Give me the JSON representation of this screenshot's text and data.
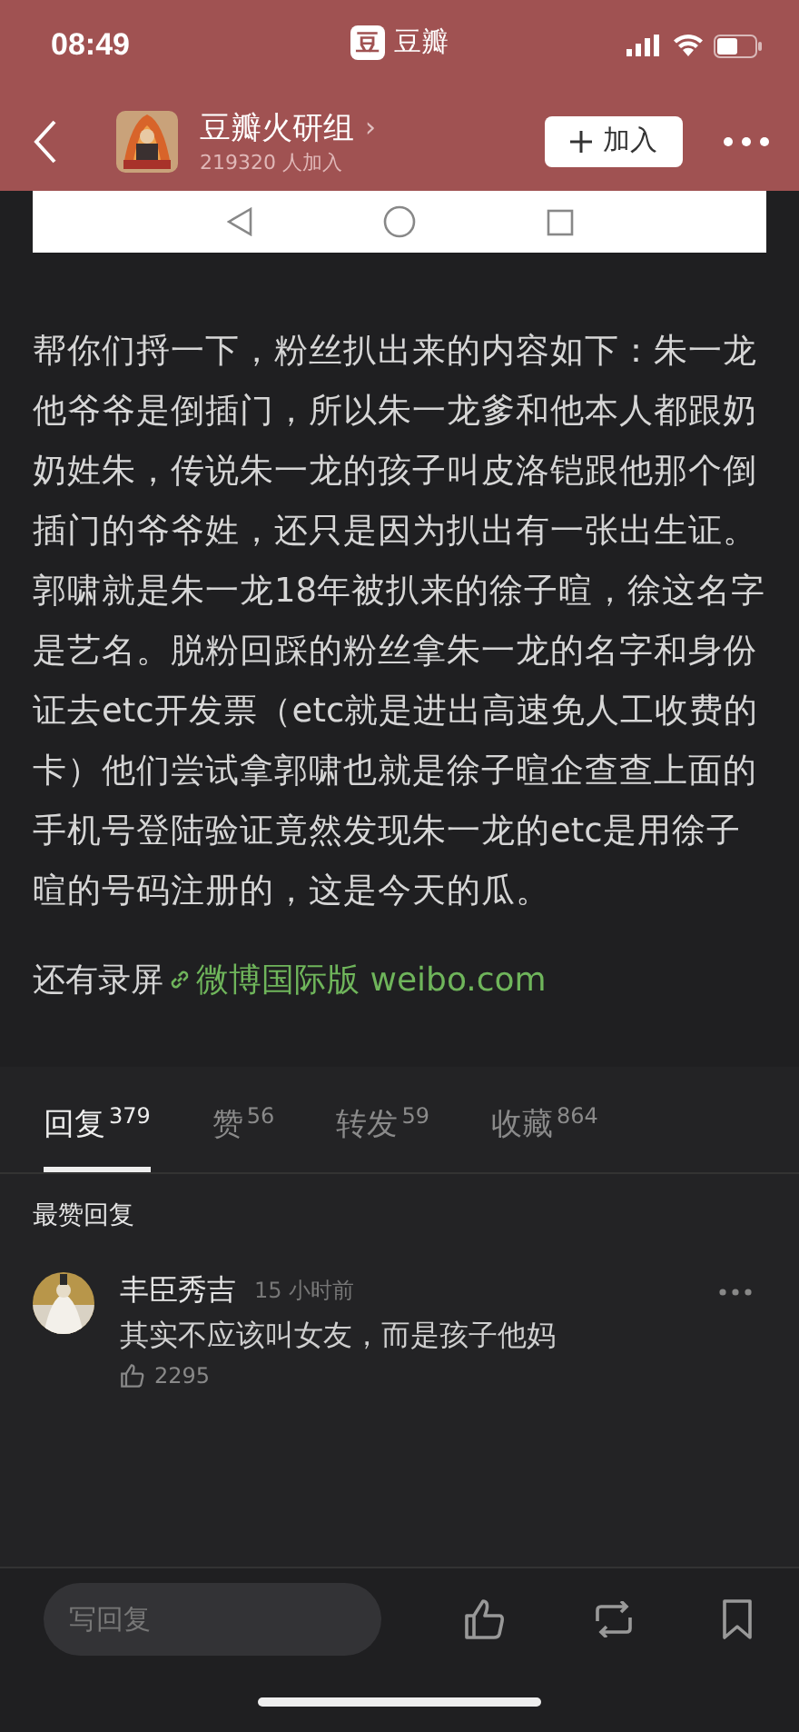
{
  "status_bar": {
    "time": "08:49",
    "app_logo": "豆",
    "app_name": "豆瓣"
  },
  "header": {
    "group_name": "豆瓣火研组",
    "chevron": "›",
    "members": "219320 人加入",
    "join_button": "加入"
  },
  "post": {
    "paragraph": "帮你们捋一下，粉丝扒出来的内容如下：朱一龙他爷爷是倒插门，所以朱一龙爹和他本人都跟奶奶姓朱，传说朱一龙的孩子叫皮洛铠跟他那个倒插门的爷爷姓，还只是因为扒出有一张出生证。郭啸就是朱一龙18年被扒来的徐子暄，徐这名字是艺名。脱粉回踩的粉丝拿朱一龙的名字和身份证去etc开发票（etc就是进出高速免人工收费的卡）他们尝试拿郭啸也就是徐子暄企查查上面的手机号登陆验证竟然发现朱一龙的etc是用徐子暄的号码注册的，这是今天的瓜。",
    "footer_text": "还有录屏",
    "link": "微博国际版 weibo.com"
  },
  "tabs": [
    {
      "label": "回复",
      "count": "379",
      "selected": true
    },
    {
      "label": "赞",
      "count": "56",
      "selected": false
    },
    {
      "label": "转发",
      "count": "59",
      "selected": false
    },
    {
      "label": "收藏",
      "count": "864",
      "selected": false
    }
  ],
  "section_title": "最赞回复",
  "comments": [
    {
      "author": "丰臣秀吉",
      "time": "15 小时前",
      "text": "其实不应该叫女友，而是孩子他妈",
      "likes": "2295"
    }
  ],
  "reply_field": {
    "placeholder": "写回复"
  }
}
